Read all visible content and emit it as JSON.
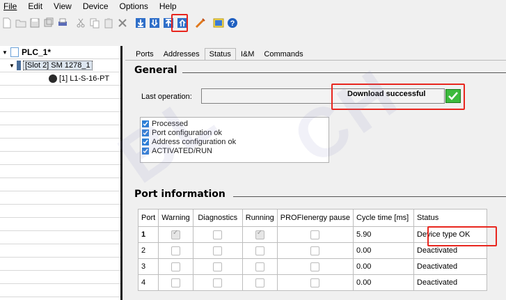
{
  "menu": [
    "File",
    "Edit",
    "View",
    "Device",
    "Options",
    "Help"
  ],
  "tree": {
    "root": "PLC_1*",
    "module": "[Slot 2] SM 1278_1",
    "port": "[1] L1-S-16-PT"
  },
  "tabs": [
    "Ports",
    "Addresses",
    "Status",
    "I&M",
    "Commands"
  ],
  "general": {
    "title": "General",
    "last_operation_label": "Last operation:",
    "last_operation_value": "Download successful",
    "status_items": [
      "Processed",
      "Port configuration ok",
      "Address configuration ok",
      "ACTIVATED/RUN"
    ]
  },
  "port_info": {
    "title": "Port information",
    "headers": [
      "Port",
      "Warning",
      "Diagnostics",
      "Running",
      "PROFIenergy pause",
      "Cycle time [ms]",
      "Status"
    ],
    "rows": [
      {
        "port": "1",
        "warning": true,
        "diagnostics": false,
        "running": true,
        "pause": false,
        "cycle": "5.90",
        "status": "Device type OK"
      },
      {
        "port": "2",
        "warning": false,
        "diagnostics": false,
        "running": false,
        "pause": false,
        "cycle": "0.00",
        "status": "Deactivated"
      },
      {
        "port": "3",
        "warning": false,
        "diagnostics": false,
        "running": false,
        "pause": false,
        "cycle": "0.00",
        "status": "Deactivated"
      },
      {
        "port": "4",
        "warning": false,
        "diagnostics": false,
        "running": false,
        "pause": false,
        "cycle": "0.00",
        "status": "Deactivated"
      }
    ]
  },
  "watermark": "BLCH",
  "colors": {
    "highlight": "#e8261e",
    "ok_green": "#3cba3c",
    "check_blue": "#2f7fd6"
  }
}
